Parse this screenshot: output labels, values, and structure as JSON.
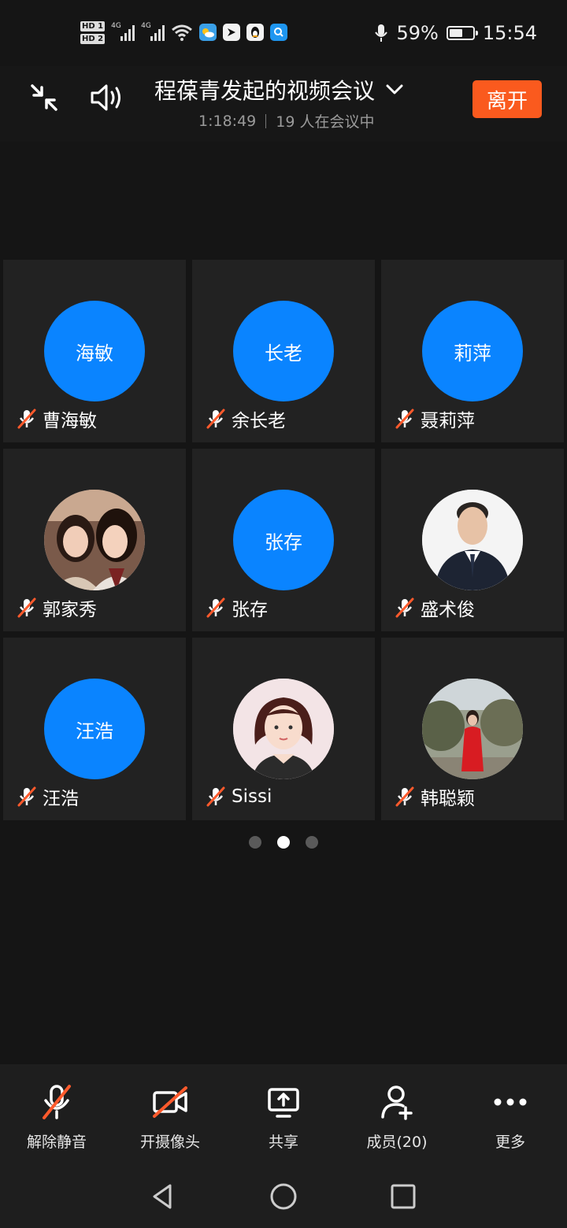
{
  "status_bar": {
    "sim1": "HD 1",
    "sim2": "HD 2",
    "network1": "4G",
    "network2": "4G",
    "battery_percent": "59%",
    "battery_level": 0.59,
    "time": "15:54",
    "icons": [
      "signal-icon",
      "wifi-icon",
      "weather-app-icon",
      "bird-app-icon",
      "penguin-app-icon",
      "search-app-icon",
      "microphone-icon",
      "battery-icon"
    ]
  },
  "header": {
    "title": "程葆青发起的视频会议",
    "elapsed": "1:18:49",
    "participants_text": "19 人在会议中",
    "leave_label": "离开"
  },
  "participants": [
    {
      "initials": "海敏",
      "name": "曹海敏",
      "avatar": "initials",
      "muted": true
    },
    {
      "initials": "长老",
      "name": "余长老",
      "avatar": "initials",
      "muted": true
    },
    {
      "initials": "莉萍",
      "name": "聂莉萍",
      "avatar": "initials",
      "muted": true
    },
    {
      "initials": "",
      "name": "郭家秀",
      "avatar": "photo",
      "muted": true
    },
    {
      "initials": "张存",
      "name": "张存",
      "avatar": "initials",
      "muted": true
    },
    {
      "initials": "",
      "name": "盛术俊",
      "avatar": "photo",
      "muted": true
    },
    {
      "initials": "汪浩",
      "name": "汪浩",
      "avatar": "initials",
      "muted": true
    },
    {
      "initials": "",
      "name": "Sissi",
      "avatar": "photo",
      "muted": true
    },
    {
      "initials": "",
      "name": "韩聪颖",
      "avatar": "photo",
      "muted": true
    }
  ],
  "pagination": {
    "pages": 3,
    "current": 2
  },
  "toolbar": {
    "unmute_label": "解除静音",
    "camera_label": "开摄像头",
    "share_label": "共享",
    "members_label": "成员(20)",
    "more_label": "更多"
  },
  "colors": {
    "accent_blue": "#0a84ff",
    "leave_orange": "#fa5a1e",
    "muted_red": "#ff5a2c",
    "background": "#151515",
    "tile": "#222222"
  }
}
